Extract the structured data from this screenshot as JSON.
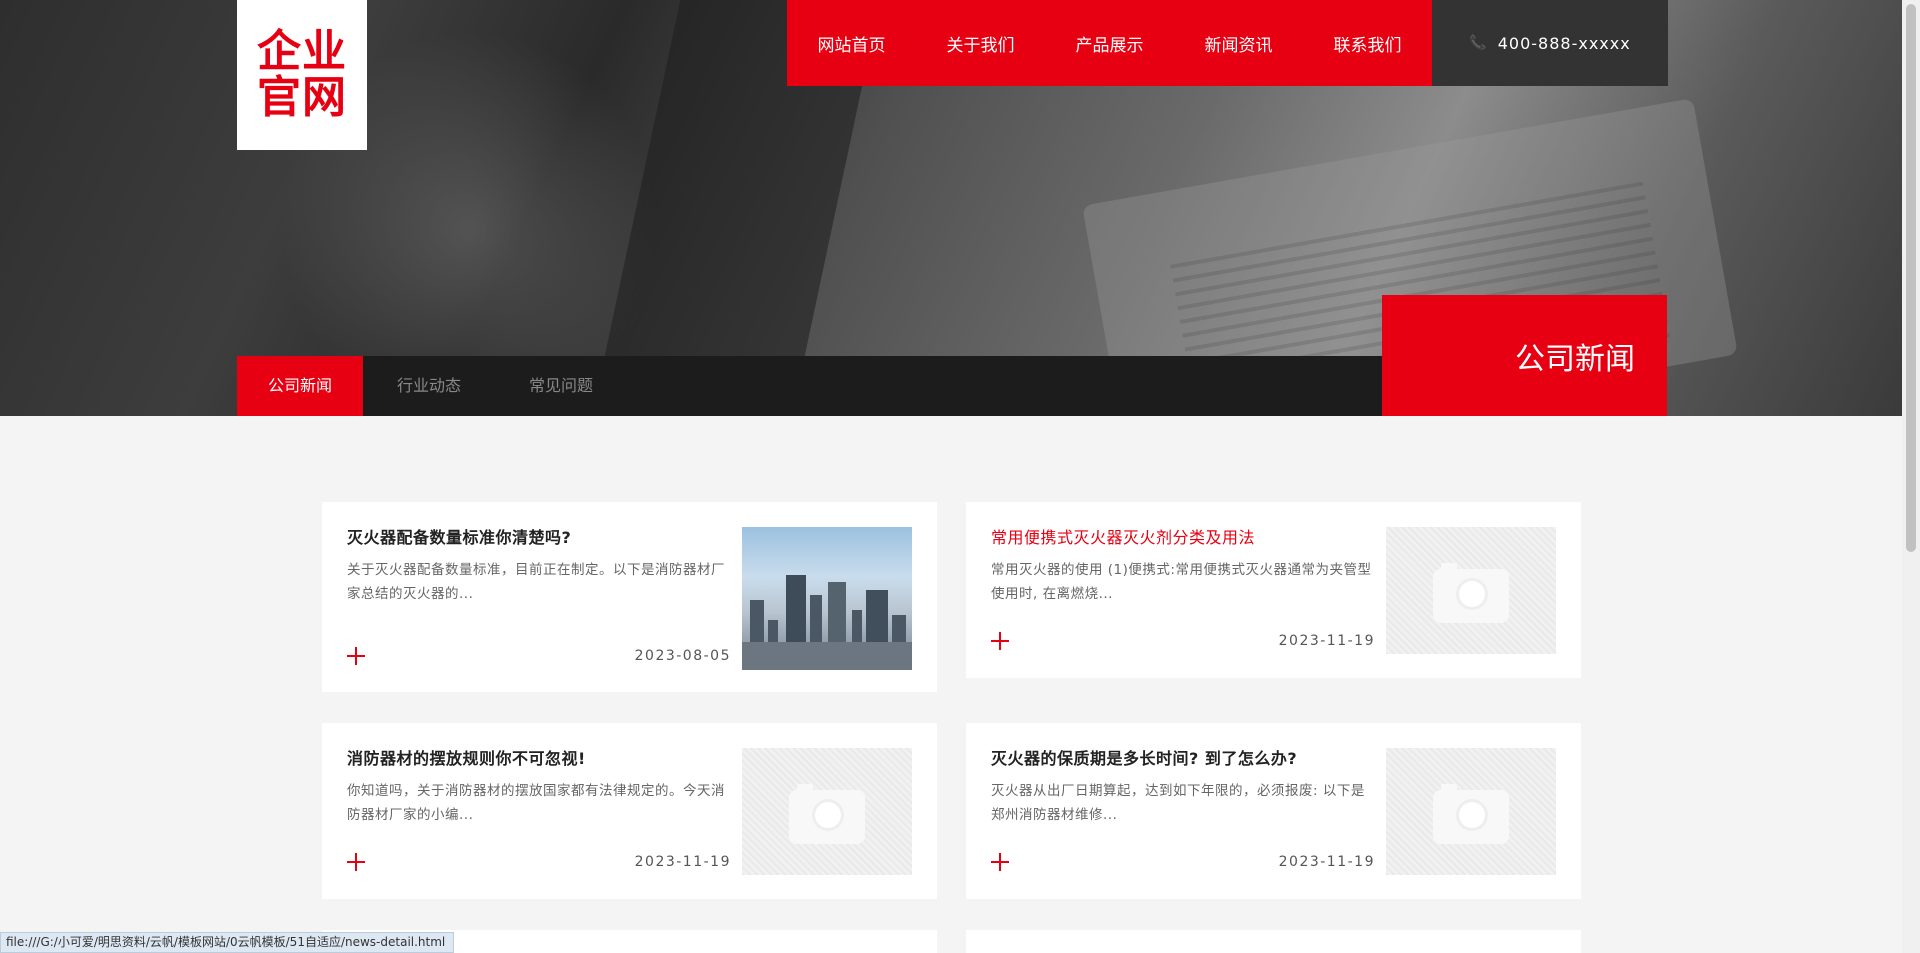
{
  "logo": {
    "line1": "企业",
    "line2": "官网"
  },
  "nav": {
    "items": [
      "网站首页",
      "关于我们",
      "产品展示",
      "新闻资讯",
      "联系我们"
    ]
  },
  "phone": {
    "number": "400-888-xxxxx"
  },
  "subnav": {
    "tabs": [
      "公司新闻",
      "行业动态",
      "常见问题"
    ],
    "active": 0
  },
  "section_title": "公司新闻",
  "news": [
    {
      "title": "灭火器配备数量标准你清楚吗?",
      "desc": "关于灭火器配备数量标准，目前正在制定。以下是消防器材厂家总结的灭火器的...",
      "date": "2023-08-05",
      "image": "city-photo",
      "highlight": false
    },
    {
      "title": "常用便携式灭火器灭火剂分类及用法",
      "desc": "常用灭火器的使用 (1)便携式:常用便携式灭火器通常为夹管型 使用时, 在离燃烧...",
      "date": "2023-11-19",
      "image": "placeholder",
      "highlight": true
    },
    {
      "title": "消防器材的摆放规则你不可忽视!",
      "desc": "你知道吗，关于消防器材的摆放国家都有法律规定的。今天消防器材厂家的小编...",
      "date": "2023-11-19",
      "image": "placeholder",
      "highlight": false
    },
    {
      "title": "灭火器的保质期是多长时间? 到了怎么办?",
      "desc": "灭火器从出厂日期算起，达到如下年限的，必须报废: 以下是郑州消防器材维修...",
      "date": "2023-11-19",
      "image": "placeholder",
      "highlight": false
    }
  ],
  "statusbar": {
    "url": "file:///G:/小可爱/明思资料/云帆/模板网站/0云帆模板/51自适应/news-detail.html"
  },
  "colors": {
    "accent": "#e60012",
    "dark": "#1c1c1c",
    "phone_bg": "#333333"
  }
}
